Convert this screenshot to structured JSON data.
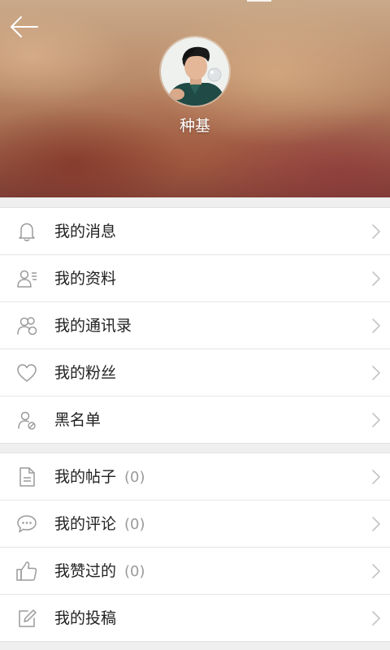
{
  "profile": {
    "username": "种基",
    "avatar_icon": "user-avatar-photo"
  },
  "colors": {
    "accent_text": "#222222",
    "muted_text": "#9a9a9a",
    "icon_gray": "#9a9a9a"
  },
  "menu_group_1": [
    {
      "label": "我的消息",
      "icon": "bell-icon"
    },
    {
      "label": "我的资料",
      "icon": "profile-card-icon"
    },
    {
      "label": "我的通讯录",
      "icon": "contacts-icon"
    },
    {
      "label": "我的粉丝",
      "icon": "heart-icon"
    },
    {
      "label": "黑名单",
      "icon": "blocked-user-icon"
    }
  ],
  "menu_group_2": [
    {
      "label": "我的帖子",
      "count": "(0)",
      "icon": "document-icon"
    },
    {
      "label": "我的评论",
      "count": "(0)",
      "icon": "comment-icon"
    },
    {
      "label": "我赞过的",
      "count": "(0)",
      "icon": "thumbs-up-icon"
    },
    {
      "label": "我的投稿",
      "icon": "edit-icon"
    }
  ]
}
